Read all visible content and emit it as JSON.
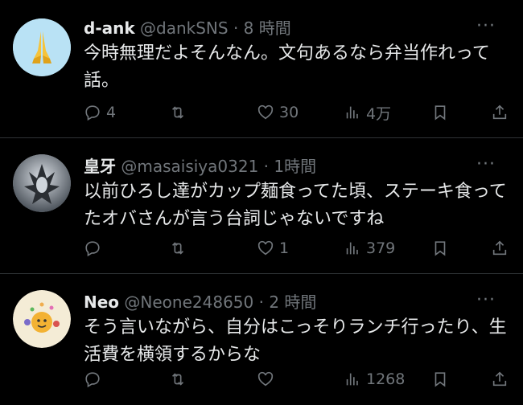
{
  "tweets": [
    {
      "name": "d-ank",
      "handle": "@dankSNS",
      "time": "· 8 時間",
      "text": "今時無理だよそんなん。文句あるなら弁当作れって話。",
      "reply_count": "4",
      "retweet_count": "",
      "like_count": "30",
      "view_count": "4万",
      "avatar": "folded-hands-emoji"
    },
    {
      "name": "皇牙",
      "handle": "@masaisiya0321",
      "time": "· 1時間",
      "text": "以前ひろし達がカップ麺食ってた頃、ステーキ食ってたオバさんが言う台詞じゃないですね",
      "reply_count": "",
      "retweet_count": "",
      "like_count": "1",
      "view_count": "379",
      "avatar": "armored-figure-photo"
    },
    {
      "name": "Neo",
      "handle": "@Neone248650",
      "time": "· 2 時間",
      "text": "そう言いながら、自分はこっそりランチ行ったり、生活費を横領するからな",
      "reply_count": "",
      "retweet_count": "",
      "like_count": "",
      "view_count": "1268",
      "avatar": "cartoon-sun-character"
    }
  ],
  "more_icon": "···",
  "colors": {
    "bg": "#000000",
    "text": "#e7e9ea",
    "muted": "#71767b",
    "divider": "#2f3336"
  }
}
